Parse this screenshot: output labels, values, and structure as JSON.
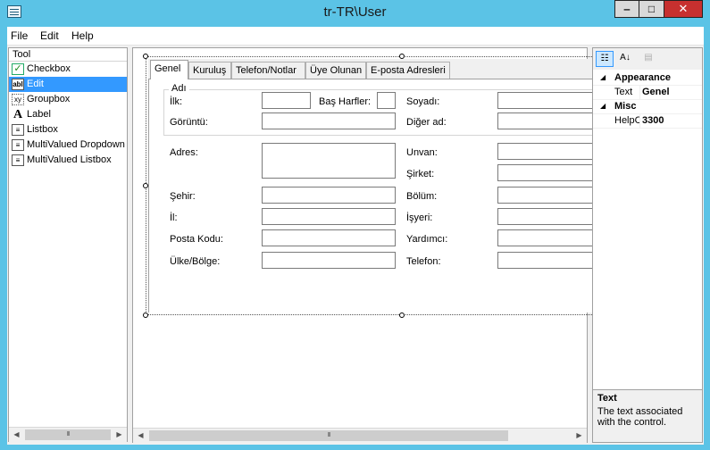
{
  "window": {
    "title": "tr-TR\\User",
    "minimize": "‒",
    "maximize": "□",
    "close": "✕"
  },
  "menu": [
    "File",
    "Edit",
    "Help"
  ],
  "toolbox": {
    "header": "Tool",
    "items": [
      {
        "label": "Checkbox",
        "icon": "checkbox-icon",
        "glyph": "✓"
      },
      {
        "label": "Edit",
        "icon": "edit-icon",
        "glyph": "abl",
        "selected": true
      },
      {
        "label": "Groupbox",
        "icon": "groupbox-icon",
        "glyph": "xy"
      },
      {
        "label": "Label",
        "icon": "label-icon",
        "glyph": "A"
      },
      {
        "label": "Listbox",
        "icon": "listbox-icon",
        "glyph": "≡"
      },
      {
        "label": "MultiValued Dropdown",
        "icon": "multivalued-dropdown-icon",
        "glyph": "≡"
      },
      {
        "label": "MultiValued Listbox",
        "icon": "multivalued-listbox-icon",
        "glyph": "≡"
      }
    ]
  },
  "form": {
    "tabs": [
      "Genel",
      "Kuruluş",
      "Telefon/Notlar",
      "Üye Olunan",
      "E-posta Adresleri"
    ],
    "active_tab": 0,
    "group_title": "Adı",
    "labels": {
      "first_name": "İlk:",
      "initials": "Baş Harfler:",
      "last_name": "Soyadı:",
      "display": "Görüntü:",
      "other_name": "Diğer ad:",
      "address": "Adres:",
      "title": "Unvan:",
      "company": "Şirket:",
      "city": "Şehir:",
      "department": "Bölüm:",
      "province": "İl:",
      "office": "İşyeri:",
      "postal_code": "Posta Kodu:",
      "assistant": "Yardımcı:",
      "country": "Ülke/Bölge:",
      "phone": "Telefon:"
    }
  },
  "properties": {
    "categories": [
      {
        "name": "Appearance",
        "props": [
          {
            "name": "Text",
            "value": "Genel"
          }
        ]
      },
      {
        "name": "Misc",
        "props": [
          {
            "name": "HelpC",
            "value": "3300"
          }
        ]
      }
    ],
    "description_title": "Text",
    "description_text": "The text associated with the control."
  },
  "scroll": {
    "thumb_glyph": "III",
    "left_arrow": "◀",
    "right_arrow": "▶"
  }
}
